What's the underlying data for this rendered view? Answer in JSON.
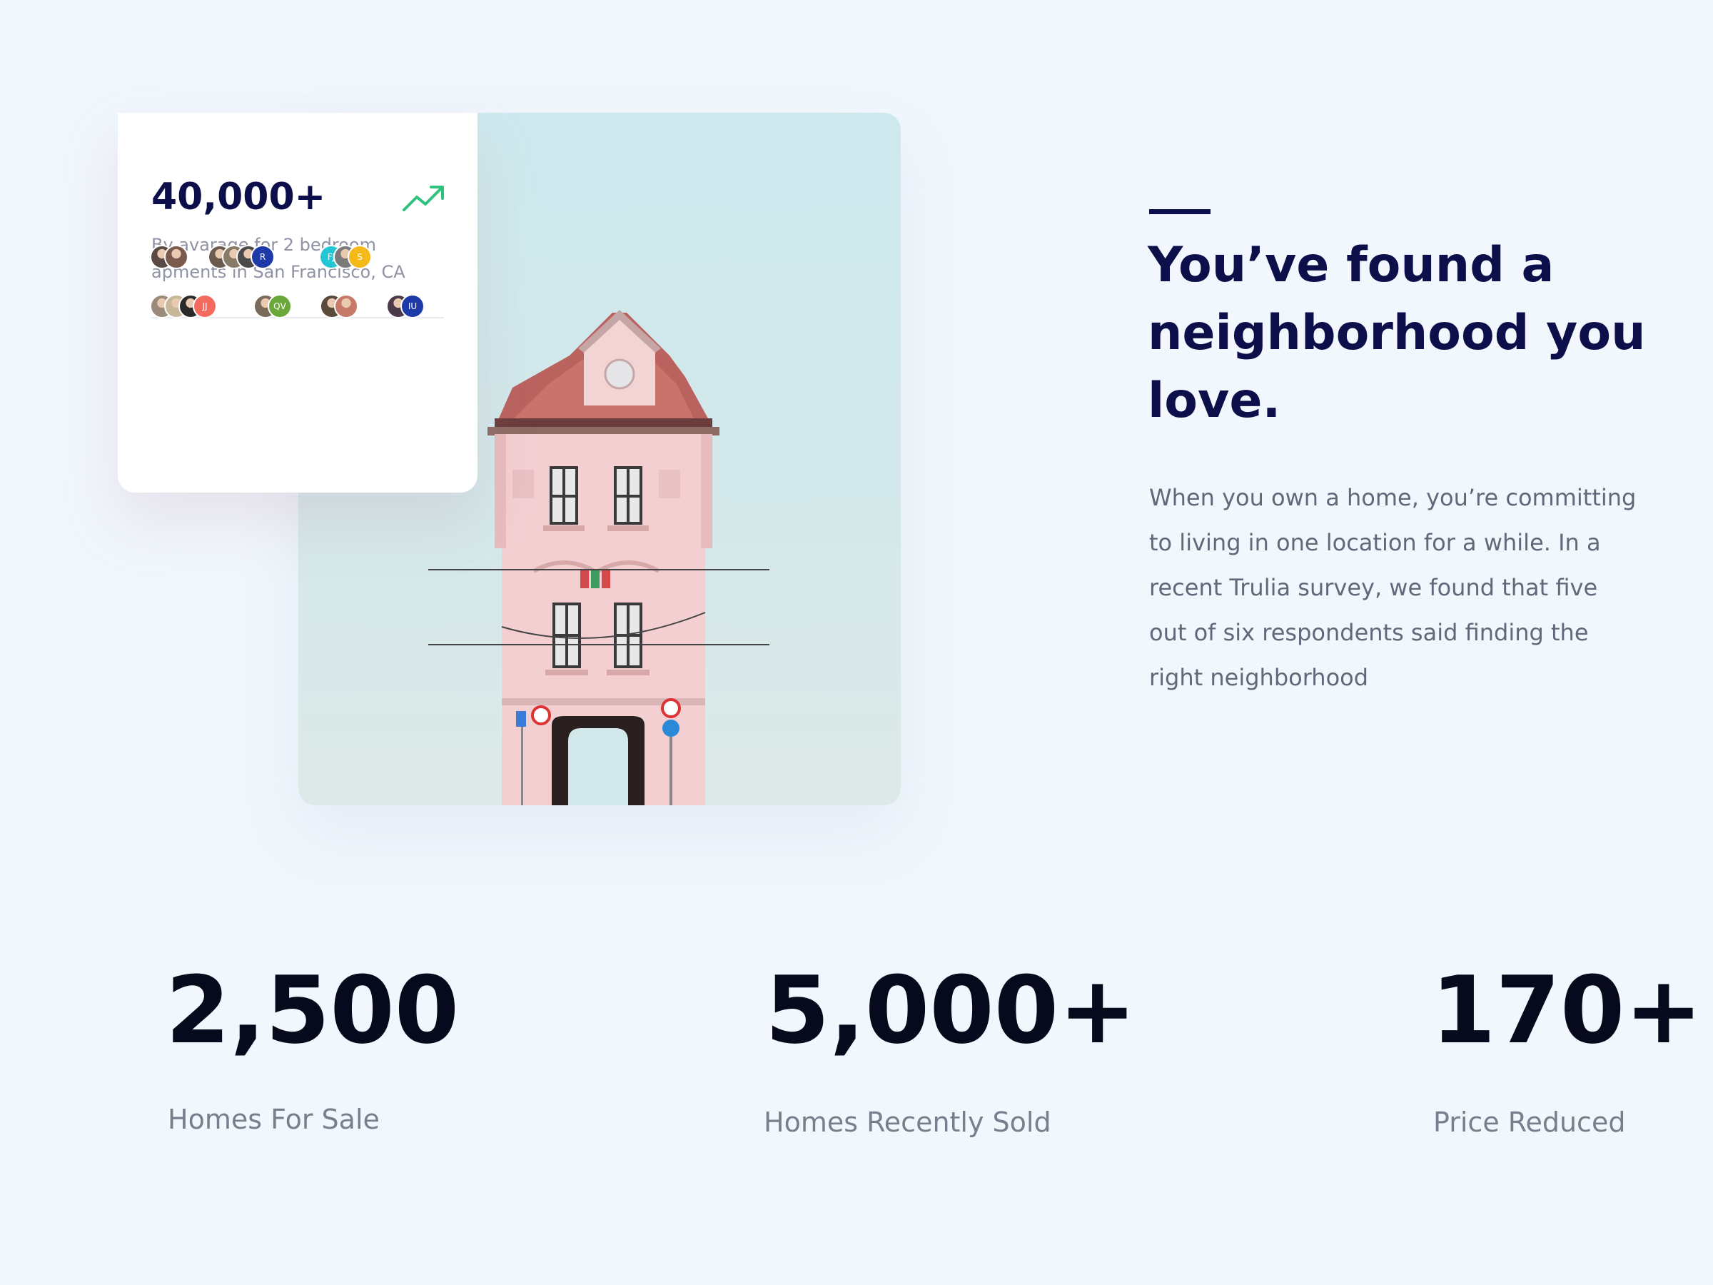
{
  "card": {
    "value": "40,000+",
    "description": "By avarage for 2 bedroom apments in San Francisco, CA",
    "trend_icon": "trending-up-icon",
    "accent_color": "#2ec27e",
    "avatar_groups": [
      {
        "avatars": [
          {
            "type": "photo",
            "color": "#5b4a44"
          },
          {
            "type": "photo",
            "color": "#7a5a4c"
          }
        ]
      },
      {
        "avatars": [
          {
            "type": "photo",
            "color": "#6b5b4e"
          },
          {
            "type": "photo",
            "color": "#8a7a6a"
          },
          {
            "type": "photo",
            "color": "#4a4a4a"
          },
          {
            "type": "initials",
            "text": "R",
            "color": "#1e3aa8"
          }
        ]
      },
      {
        "avatars": [
          {
            "type": "initials",
            "text": "FJ",
            "color": "#22c7d6"
          },
          {
            "type": "photo",
            "color": "#7a7a7a"
          },
          {
            "type": "initials",
            "text": "S",
            "color": "#f5b918"
          }
        ]
      },
      {
        "avatars": [
          {
            "type": "photo",
            "color": "#9a8a7a"
          },
          {
            "type": "photo",
            "color": "#c8b89a"
          },
          {
            "type": "photo",
            "color": "#2a2a2a"
          },
          {
            "type": "initials",
            "text": "JJ",
            "color": "#f26b5e"
          }
        ]
      },
      {
        "avatars": [
          {
            "type": "photo",
            "color": "#7a6a5a"
          },
          {
            "type": "initials",
            "text": "QV",
            "color": "#6aa83a"
          }
        ]
      },
      {
        "avatars": [
          {
            "type": "photo",
            "color": "#5a4a3a"
          },
          {
            "type": "photo",
            "color": "#c87a6a"
          }
        ]
      },
      {
        "avatars": [
          {
            "type": "photo",
            "color": "#4a3a4a"
          },
          {
            "type": "initials",
            "text": "IU",
            "color": "#1e3aa8"
          }
        ]
      }
    ]
  },
  "feature": {
    "headline": "You’ve found a neighborhood you love.",
    "body": "When you own a home, you’re committing to living in one location for a while. In a recent Trulia survey, we found that five out of six respondents said finding the right neighborhood"
  },
  "stats": [
    {
      "value": "2,500",
      "label": "Homes For Sale"
    },
    {
      "value": "5,000+",
      "label": "Homes Recently Sold"
    },
    {
      "value": "170+",
      "label": "Price Reduced"
    }
  ]
}
